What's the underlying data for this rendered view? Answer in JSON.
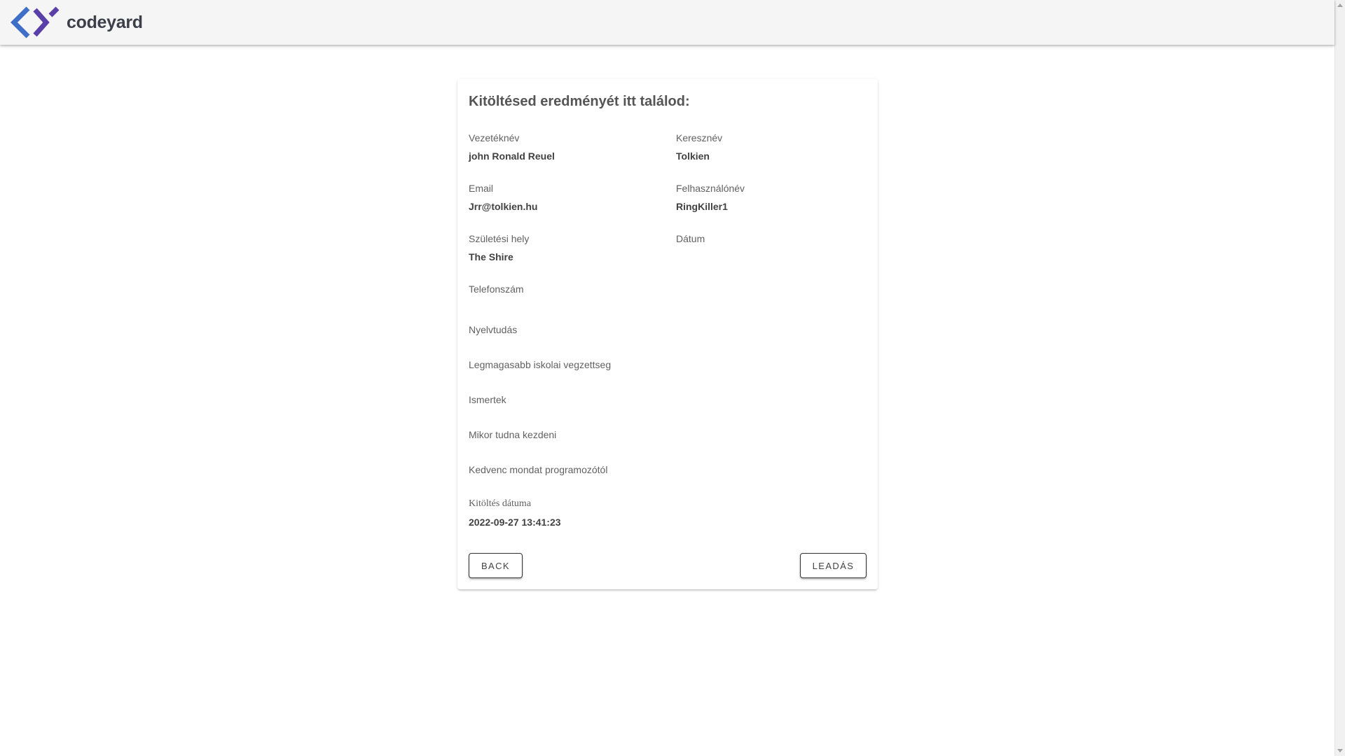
{
  "header": {
    "logo_text": "codeyard",
    "colors": {
      "chevron_left": "#3f6fc6",
      "chevron_right": "#5b3fa8",
      "bar": "#f5f5f5"
    }
  },
  "card": {
    "title": "Kitöltésed eredményét itt találod:",
    "fields": {
      "last_name": {
        "label": "Vezetéknév",
        "value": "john Ronald Reuel"
      },
      "first_name": {
        "label": "Keresznév",
        "value": "Tolkien"
      },
      "email": {
        "label": "Email",
        "value": "Jrr@tolkien.hu"
      },
      "username": {
        "label": "Felhasználónév",
        "value": "RingKiller1"
      },
      "birth_place": {
        "label": "Születési hely",
        "value": "The Shire"
      },
      "date": {
        "label": "Dátum",
        "value": ""
      },
      "phone": {
        "label": "Telefonszám",
        "value": ""
      },
      "languages": {
        "label": "Nyelvtudás",
        "value": ""
      },
      "education": {
        "label": "Legmagasabb iskolai vegzettseg",
        "value": ""
      },
      "knowledge": {
        "label": "Ismertek",
        "value": ""
      },
      "start_time": {
        "label": "Mikor tudna kezdeni",
        "value": ""
      },
      "favorite_quote": {
        "label": "Kedvenc mondat programozótól",
        "value": ""
      },
      "submitted_at": {
        "label": "Kitöltés dátuma",
        "value": "2022-09-27 13:41:23"
      }
    },
    "buttons": {
      "back": "BACK",
      "submit": "LEADÁS"
    }
  }
}
